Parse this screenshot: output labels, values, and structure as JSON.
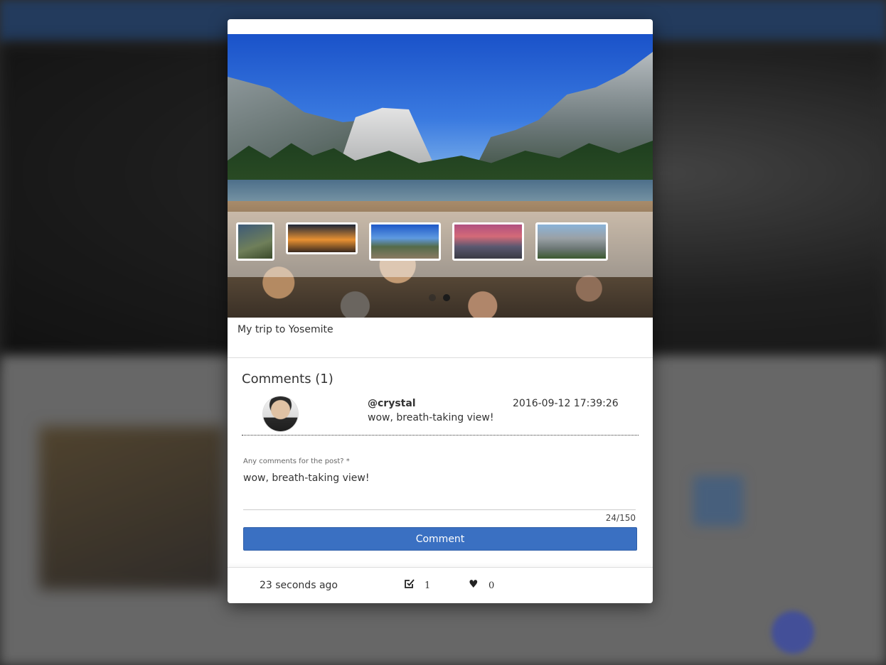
{
  "post": {
    "caption": "My trip to Yosemite",
    "gallery": {
      "thumbnails": [
        "thumbnail-1",
        "thumbnail-2",
        "thumbnail-3",
        "thumbnail-4",
        "thumbnail-5"
      ],
      "active_dot": 2,
      "dot_count": 2
    }
  },
  "comments": {
    "title": "Comments (1)",
    "items": [
      {
        "username": "@crystal",
        "timestamp": "2016-09-12 17:39:26",
        "text": "wow, breath-taking view!"
      }
    ]
  },
  "form": {
    "label": "Any comments for the post? *",
    "value": "wow, breath-taking view!",
    "counter": "24/150",
    "submit_label": "Comment"
  },
  "footer": {
    "time_ago": "23 seconds ago",
    "edit_count": "1",
    "like_count": "0"
  },
  "colors": {
    "accent": "#3a70c2"
  },
  "icons": {
    "edit": "edit-square-icon",
    "like": "heart-icon"
  }
}
